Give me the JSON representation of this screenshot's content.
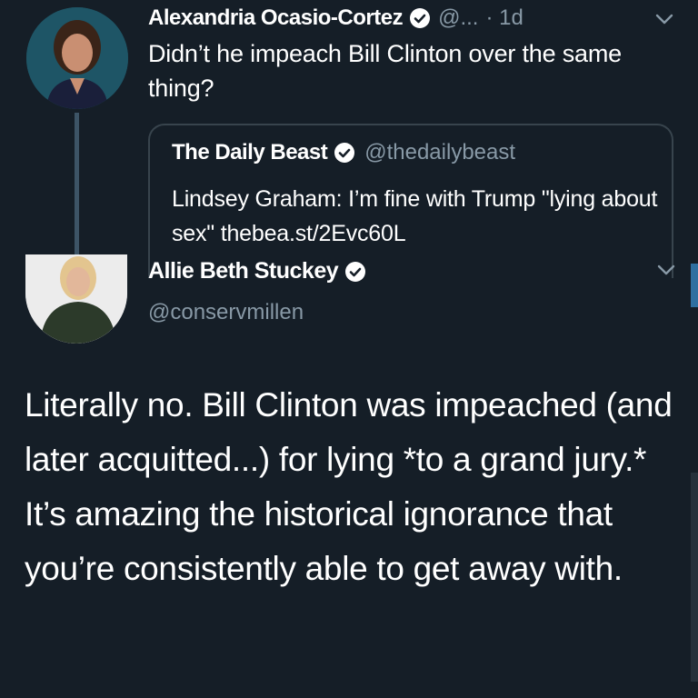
{
  "tweet_main": {
    "author_name": "Alexandria Ocasio-Cortez",
    "handle": "@...",
    "time": "· 1d",
    "text": "Didn’t he impeach Bill Clinton over the same thing?",
    "avatar_icon": "person-avatar",
    "menu_icon": "chevron-down-icon",
    "quoted": {
      "author_name": "The Daily Beast",
      "handle": "@thedailybeast",
      "text": "Lindsey Graham: I’m fine with Trump \"lying about sex\" thebea.st/2Evc60L"
    }
  },
  "tweet_reply": {
    "author_name": "Allie Beth Stuckey",
    "handle": "@conservmillen",
    "text": "Literally no. Bill Clinton was impeached (and later acquitted...) for lying *to a grand jury.* It’s amazing the historical ignorance that you’re consistently able to get away with.",
    "avatar_icon": "person-avatar",
    "menu_icon": "chevron-down-icon"
  },
  "colors": {
    "background": "#151e27",
    "muted_text": "#8899a6",
    "verified_blue": "#ffffff",
    "card_border": "#38444d"
  }
}
